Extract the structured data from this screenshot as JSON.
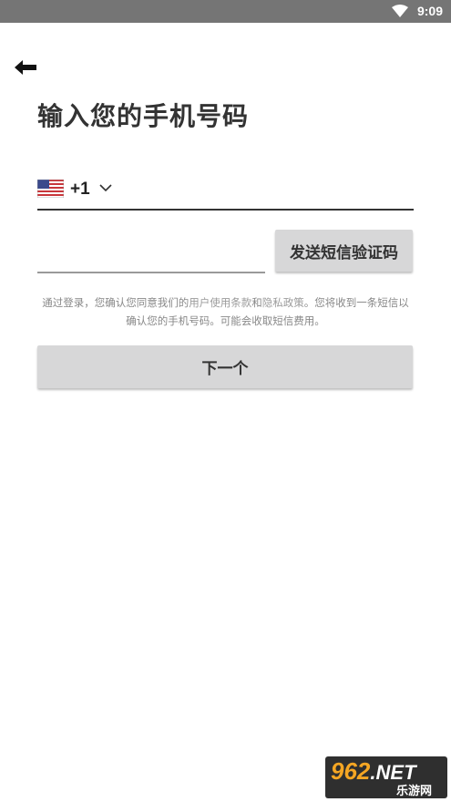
{
  "status_bar": {
    "time": "9:09",
    "wifi_icon": "wifi-icon"
  },
  "header": {
    "back_icon": "arrow-left-icon",
    "title": "输入您的手机号码"
  },
  "phone": {
    "flag_icon": "us-flag-icon",
    "country_code": "+1",
    "dropdown_icon": "chevron-down-icon",
    "value": "",
    "placeholder": ""
  },
  "verification": {
    "value": "",
    "placeholder": "",
    "send_label": "发送短信验证码"
  },
  "consent": {
    "prefix": "通过登录，您确认您同意我们的",
    "terms_link": "用户使用条款",
    "and": "和",
    "privacy_link": "隐私政策",
    "suffix": "。您将收到一条短信以确认您的手机号码。可能会收取短信费用。"
  },
  "next_label": "下一个",
  "watermark": {
    "logo_number": "962",
    "logo_suffix": ".NET",
    "sub": "乐游网"
  },
  "colors": {
    "status_bar": "#757575",
    "button_bg": "#d7d7d8",
    "title_text": "#333333",
    "hint_text": "#888888"
  }
}
